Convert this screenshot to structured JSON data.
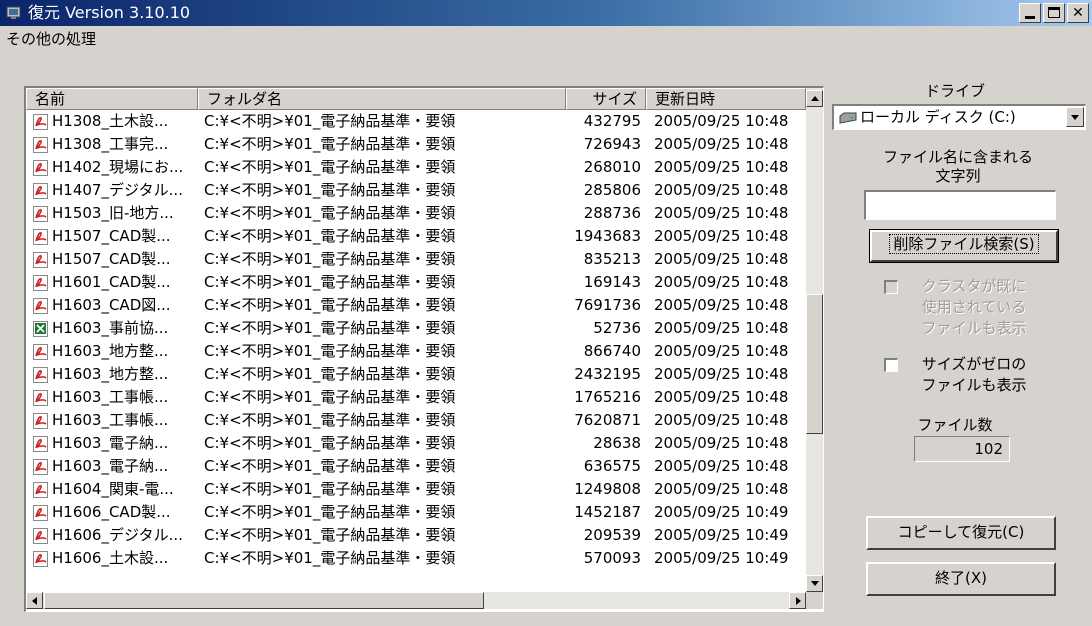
{
  "window": {
    "title": "復元 Version 3.10.10"
  },
  "menu": {
    "other": "その他の処理"
  },
  "list": {
    "columns": {
      "name": "名前",
      "folder": "フォルダ名",
      "size": "サイズ",
      "date": "更新日時"
    },
    "rows": [
      {
        "icon": "pdf-icon",
        "name": "H1308_土木設...",
        "folder": "C:¥<不明>¥01_電子納品基準・要領",
        "size": "432795",
        "date": "2005/09/25 10:48"
      },
      {
        "icon": "pdf-icon",
        "name": "H1308_工事完...",
        "folder": "C:¥<不明>¥01_電子納品基準・要領",
        "size": "726943",
        "date": "2005/09/25 10:48"
      },
      {
        "icon": "pdf-icon",
        "name": "H1402_現場にお...",
        "folder": "C:¥<不明>¥01_電子納品基準・要領",
        "size": "268010",
        "date": "2005/09/25 10:48"
      },
      {
        "icon": "pdf-icon",
        "name": "H1407_デジタル...",
        "folder": "C:¥<不明>¥01_電子納品基準・要領",
        "size": "285806",
        "date": "2005/09/25 10:48"
      },
      {
        "icon": "pdf-icon",
        "name": "H1503_旧-地方...",
        "folder": "C:¥<不明>¥01_電子納品基準・要領",
        "size": "288736",
        "date": "2005/09/25 10:48"
      },
      {
        "icon": "pdf-icon",
        "name": "H1507_CAD製...",
        "folder": "C:¥<不明>¥01_電子納品基準・要領",
        "size": "1943683",
        "date": "2005/09/25 10:48"
      },
      {
        "icon": "pdf-icon",
        "name": "H1507_CAD製...",
        "folder": "C:¥<不明>¥01_電子納品基準・要領",
        "size": "835213",
        "date": "2005/09/25 10:48"
      },
      {
        "icon": "pdf-icon",
        "name": "H1601_CAD製...",
        "folder": "C:¥<不明>¥01_電子納品基準・要領",
        "size": "169143",
        "date": "2005/09/25 10:48"
      },
      {
        "icon": "pdf-icon",
        "name": "H1603_CAD図...",
        "folder": "C:¥<不明>¥01_電子納品基準・要領",
        "size": "7691736",
        "date": "2005/09/25 10:48"
      },
      {
        "icon": "excel-icon",
        "name": "H1603_事前協...",
        "folder": "C:¥<不明>¥01_電子納品基準・要領",
        "size": "52736",
        "date": "2005/09/25 10:48"
      },
      {
        "icon": "pdf-icon",
        "name": "H1603_地方整...",
        "folder": "C:¥<不明>¥01_電子納品基準・要領",
        "size": "866740",
        "date": "2005/09/25 10:48"
      },
      {
        "icon": "pdf-icon",
        "name": "H1603_地方整...",
        "folder": "C:¥<不明>¥01_電子納品基準・要領",
        "size": "2432195",
        "date": "2005/09/25 10:48"
      },
      {
        "icon": "pdf-icon",
        "name": "H1603_工事帳...",
        "folder": "C:¥<不明>¥01_電子納品基準・要領",
        "size": "1765216",
        "date": "2005/09/25 10:48"
      },
      {
        "icon": "pdf-icon",
        "name": "H1603_工事帳...",
        "folder": "C:¥<不明>¥01_電子納品基準・要領",
        "size": "7620871",
        "date": "2005/09/25 10:48"
      },
      {
        "icon": "pdf-icon",
        "name": "H1603_電子納...",
        "folder": "C:¥<不明>¥01_電子納品基準・要領",
        "size": "28638",
        "date": "2005/09/25 10:48"
      },
      {
        "icon": "pdf-icon",
        "name": "H1603_電子納...",
        "folder": "C:¥<不明>¥01_電子納品基準・要領",
        "size": "636575",
        "date": "2005/09/25 10:48"
      },
      {
        "icon": "pdf-icon",
        "name": "H1604_関東-電...",
        "folder": "C:¥<不明>¥01_電子納品基準・要領",
        "size": "1249808",
        "date": "2005/09/25 10:48"
      },
      {
        "icon": "pdf-icon",
        "name": "H1606_CAD製...",
        "folder": "C:¥<不明>¥01_電子納品基準・要領",
        "size": "1452187",
        "date": "2005/09/25 10:49"
      },
      {
        "icon": "pdf-icon",
        "name": "H1606_デジタル...",
        "folder": "C:¥<不明>¥01_電子納品基準・要領",
        "size": "209539",
        "date": "2005/09/25 10:49"
      },
      {
        "icon": "pdf-icon",
        "name": "H1606_土木設...",
        "folder": "C:¥<不明>¥01_電子納品基準・要領",
        "size": "570093",
        "date": "2005/09/25 10:49"
      }
    ]
  },
  "panel": {
    "drive_label": "ドライブ",
    "drive_value": "ローカル ディスク (C:)",
    "filter_label_line1": "ファイル名に含まれる",
    "filter_label_line2": "文字列",
    "filter_value": "",
    "search_button": "削除ファイル検索(S)",
    "cluster_checkbox_line1": "クラスタが既に",
    "cluster_checkbox_line2": "使用されている",
    "cluster_checkbox_line3": "ファイルも表示",
    "zero_checkbox_line1": "サイズがゼロの",
    "zero_checkbox_line2": "ファイルも表示",
    "file_count_label": "ファイル数",
    "file_count_value": "102",
    "copy_restore_button": "コピーして復元(C)",
    "exit_button": "終了(X)"
  },
  "colors": {
    "titlebar_start": "#0a246a",
    "titlebar_end": "#a6caf0",
    "face": "#d6d3ce",
    "pdf_icon": "#cc2222",
    "excel_icon": "#1f7a3a"
  }
}
